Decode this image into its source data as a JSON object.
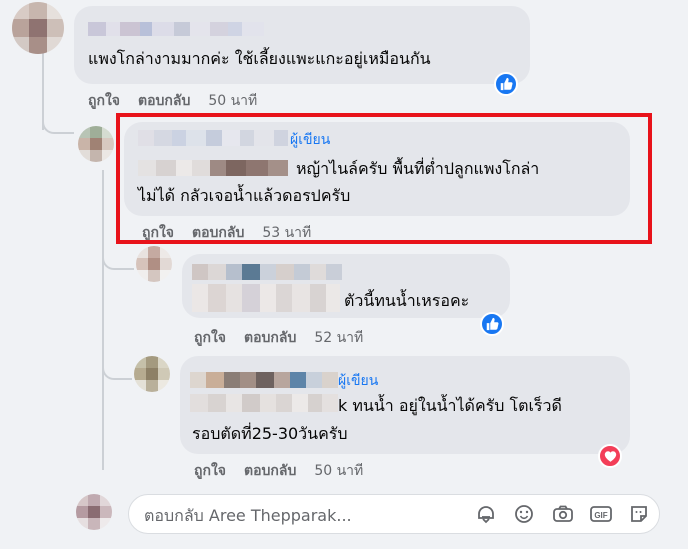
{
  "comments": [
    {
      "id": "c1",
      "text": "แพงโกล่างามมากค่ะ ใช้เลี้ยงแพะแกะอยู่เหมือนกัน",
      "like_label": "ถูกใจ",
      "reply_label": "ตอบกลับ",
      "time": "50 นาที",
      "reaction": "like"
    },
    {
      "id": "c2",
      "author_badge": "ผู้เขียน",
      "text_line1": "หญ้าไนล์ครับ พื้นที่ต่ำปลูกแพงโกล่า",
      "text_line2": "ไม่ได้ กลัวเจอน้ำแล้วดอรปครับ",
      "like_label": "ถูกใจ",
      "reply_label": "ตอบกลับ",
      "time": "53 นาที",
      "highlighted": true
    },
    {
      "id": "c3",
      "text": "ตัวนี้ทนน้ำเหรอคะ",
      "like_label": "ถูกใจ",
      "reply_label": "ตอบกลับ",
      "time": "52 นาที",
      "reaction": "like"
    },
    {
      "id": "c4",
      "author_badge": "ผู้เขียน",
      "text_line1": "k ทนน้ำ อยู่ในน้ำได้ครับ โตเร็วดี",
      "text_line2": "รอบตัดที่25-30วันครับ",
      "like_label": "ถูกใจ",
      "reply_label": "ตอบกลับ",
      "time": "50 นาที",
      "reaction": "love"
    }
  ],
  "reply_box": {
    "placeholder": "ตอบกลับ Aree Thepparak..."
  },
  "icons": {
    "like": "thumbs-up-icon",
    "love": "heart-icon",
    "sticker": "sticker-icon",
    "emoji": "emoji-icon",
    "camera": "camera-icon",
    "gif": "gif-icon",
    "avatar_sticker": "avatar-sticker-icon"
  },
  "gif_label": "GIF",
  "colors": {
    "accent": "#1877f2",
    "highlight": "#e8121a",
    "love": "#f33e58",
    "bubble": "#e4e6eb",
    "muted_text": "#65676b"
  }
}
